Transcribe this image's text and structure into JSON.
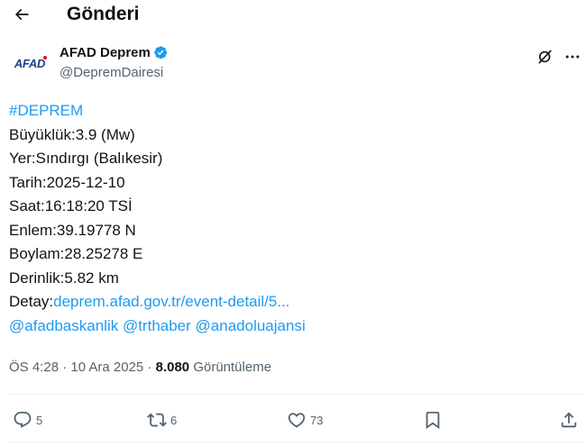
{
  "header": {
    "title": "Gönderi",
    "back_icon": "arrow-left-icon"
  },
  "author": {
    "avatar_text": "AFAD",
    "display_name": "AFAD Deprem",
    "handle": "@DepremDairesi",
    "verified": true
  },
  "tweet": {
    "hashtag": "#DEPREM",
    "magnitude": "Büyüklük:3.9 (Mw)",
    "location": "Yer:Sındırgı (Balıkesir)",
    "date": "Tarih:2025-12-10",
    "time": "Saat:16:18:20 TSİ",
    "latitude": "Enlem:39.19778 N",
    "longitude": "Boylam:28.25278 E",
    "depth": "Derinlik:5.82 km",
    "detail_label": "Detay:",
    "detail_link": "deprem.afad.gov.tr/event-detail/5...",
    "mentions": [
      "@afadbaskanlik",
      "@trthaber",
      "@anadoluajansi"
    ]
  },
  "meta": {
    "timestamp": "ÖS 4:28 · 10 Ara 2025 · ",
    "views_count": "8.080",
    "views_label": " Görüntüleme"
  },
  "actions": {
    "replies": "5",
    "reposts": "6",
    "likes": "73"
  },
  "colors": {
    "link": "#1d9bf0",
    "secondary_text": "#536471",
    "verified_badge": "#1d9bf0",
    "brand": "#1b3f8b"
  }
}
